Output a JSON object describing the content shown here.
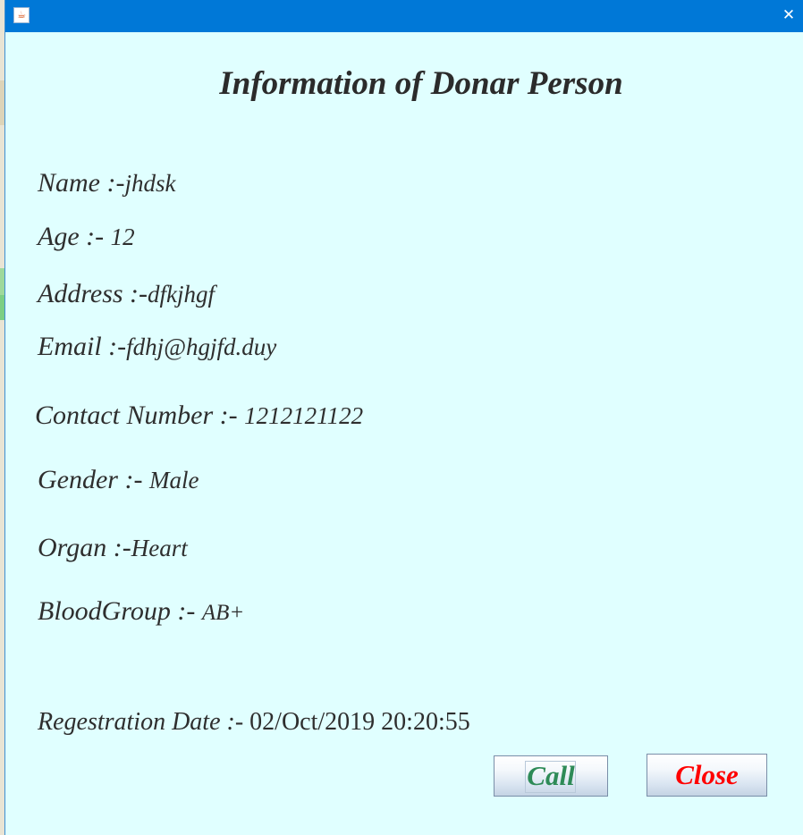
{
  "window": {
    "title_icon": "java-cup-icon",
    "close_symbol": "✕"
  },
  "heading": "Information of Donar Person",
  "fields": {
    "name": {
      "label": "Name :-",
      "value": "jhdsk"
    },
    "age": {
      "label": "Age :- ",
      "value": "12"
    },
    "address": {
      "label": "Address :-",
      "value": "dfkjhgf"
    },
    "email": {
      "label": "Email :-",
      "value": "fdhj@hgjfd.duy"
    },
    "contact": {
      "label": "Contact Number  :- ",
      "value": "1212121122"
    },
    "gender": {
      "label": "Gender :- ",
      "value": "Male"
    },
    "organ": {
      "label": "Organ :-",
      "value": "Heart"
    },
    "blood_group": {
      "label": "BloodGroup :- ",
      "value": "AB+"
    },
    "registration": {
      "label": "Regestration Date :-  ",
      "value": "02/Oct/2019 20:20:55"
    }
  },
  "buttons": {
    "call": "Call",
    "close": "Close"
  },
  "colors": {
    "titlebar": "#0078d7",
    "window_bg": "#e0ffff",
    "call_text": "#2e8b57",
    "close_text": "#ff0000"
  }
}
